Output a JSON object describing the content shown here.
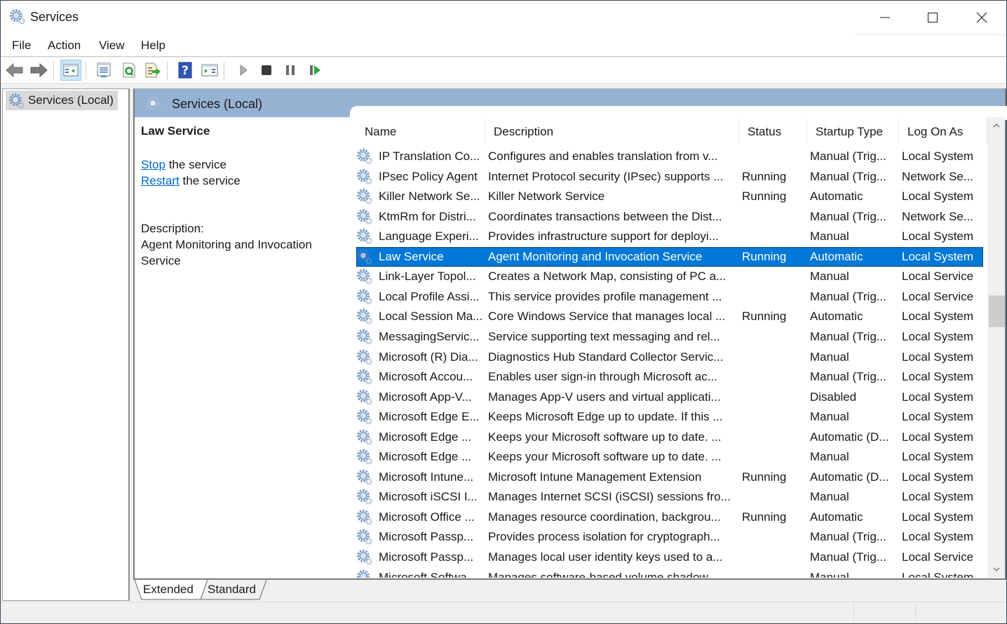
{
  "window": {
    "title": "Services",
    "app_icon": "services-gear-icon",
    "controls": {
      "minimize": "minimize-icon",
      "maximize": "maximize-icon",
      "close": "close-icon"
    }
  },
  "menu": {
    "items": [
      {
        "label": "File"
      },
      {
        "label": "Action"
      },
      {
        "label": "View"
      },
      {
        "label": "Help"
      }
    ]
  },
  "toolbar": {
    "buttons": [
      {
        "name": "back-button",
        "icon": "back-arrow-icon"
      },
      {
        "name": "forward-button",
        "icon": "forward-arrow-icon"
      },
      {
        "name": "show-hide-console-tree-button",
        "icon": "console-tree-icon",
        "active": true
      },
      {
        "name": "properties-button",
        "icon": "properties-icon"
      },
      {
        "name": "refresh-button",
        "icon": "refresh-icon"
      },
      {
        "name": "export-list-button",
        "icon": "export-list-icon"
      },
      {
        "name": "help-button",
        "icon": "help-icon",
        "glyph": "?"
      },
      {
        "name": "show-action-pane-button",
        "icon": "action-pane-icon"
      },
      {
        "name": "start-service-button",
        "icon": "play-icon"
      },
      {
        "name": "stop-service-button",
        "icon": "stop-icon"
      },
      {
        "name": "pause-service-button",
        "icon": "pause-icon"
      },
      {
        "name": "restart-service-button",
        "icon": "restart-icon"
      }
    ]
  },
  "tree": {
    "items": [
      {
        "label": "Services (Local)",
        "icon": "services-gear-icon",
        "selected": true
      }
    ]
  },
  "main": {
    "header_title": "Services (Local)",
    "info": {
      "service_name": "Law Service",
      "actions": [
        {
          "link": "Stop",
          "rest": " the service"
        },
        {
          "link": "Restart",
          "rest": " the service"
        }
      ],
      "description_label": "Description:",
      "description": "Agent Monitoring and Invocation Service"
    },
    "columns": [
      {
        "label": "Name",
        "sorted": "ascending",
        "sort_glyph": "^"
      },
      {
        "label": "Description"
      },
      {
        "label": "Status"
      },
      {
        "label": "Startup Type"
      },
      {
        "label": "Log On As"
      }
    ],
    "rows": [
      {
        "name": "IP Translation Co...",
        "description": "Configures and enables translation from v...",
        "status": "",
        "startup": "Manual (Trig...",
        "logon": "Local System"
      },
      {
        "name": "IPsec Policy Agent",
        "description": "Internet Protocol security (IPsec) supports ...",
        "status": "Running",
        "startup": "Manual (Trig...",
        "logon": "Network Se..."
      },
      {
        "name": "Killer Network Se...",
        "description": "Killer Network Service",
        "status": "Running",
        "startup": "Automatic",
        "logon": "Local System"
      },
      {
        "name": "KtmRm for Distri...",
        "description": "Coordinates transactions between the Dist...",
        "status": "",
        "startup": "Manual (Trig...",
        "logon": "Network Se..."
      },
      {
        "name": "Language Experi...",
        "description": "Provides infrastructure support for deployi...",
        "status": "",
        "startup": "Manual",
        "logon": "Local System"
      },
      {
        "name": "Law Service",
        "description": "Agent Monitoring and Invocation Service",
        "status": "Running",
        "startup": "Automatic",
        "logon": "Local System",
        "selected": true
      },
      {
        "name": "Link-Layer Topol...",
        "description": "Creates a Network Map, consisting of PC a...",
        "status": "",
        "startup": "Manual",
        "logon": "Local Service"
      },
      {
        "name": "Local Profile Assi...",
        "description": "This service provides profile management ...",
        "status": "",
        "startup": "Manual (Trig...",
        "logon": "Local Service"
      },
      {
        "name": "Local Session Ma...",
        "description": "Core Windows Service that manages local ...",
        "status": "Running",
        "startup": "Automatic",
        "logon": "Local System"
      },
      {
        "name": "MessagingServic...",
        "description": "Service supporting text messaging and rel...",
        "status": "",
        "startup": "Manual (Trig...",
        "logon": "Local System"
      },
      {
        "name": "Microsoft (R) Dia...",
        "description": "Diagnostics Hub Standard Collector Servic...",
        "status": "",
        "startup": "Manual",
        "logon": "Local System"
      },
      {
        "name": "Microsoft Accou...",
        "description": "Enables user sign-in through Microsoft ac...",
        "status": "",
        "startup": "Manual (Trig...",
        "logon": "Local System"
      },
      {
        "name": "Microsoft App-V...",
        "description": "Manages App-V users and virtual applicati...",
        "status": "",
        "startup": "Disabled",
        "logon": "Local System"
      },
      {
        "name": "Microsoft Edge E...",
        "description": "Keeps Microsoft Edge up to update. If this ...",
        "status": "",
        "startup": "Manual",
        "logon": "Local System"
      },
      {
        "name": "Microsoft Edge ...",
        "description": "Keeps your Microsoft software up to date. ...",
        "status": "",
        "startup": "Automatic (D...",
        "logon": "Local System"
      },
      {
        "name": "Microsoft Edge ...",
        "description": "Keeps your Microsoft software up to date. ...",
        "status": "",
        "startup": "Manual",
        "logon": "Local System"
      },
      {
        "name": "Microsoft Intune...",
        "description": "Microsoft Intune Management Extension",
        "status": "Running",
        "startup": "Automatic (D...",
        "logon": "Local System"
      },
      {
        "name": "Microsoft iSCSI I...",
        "description": "Manages Internet SCSI (iSCSI) sessions fro...",
        "status": "",
        "startup": "Manual",
        "logon": "Local System"
      },
      {
        "name": "Microsoft Office ...",
        "description": "Manages resource coordination, backgrou...",
        "status": "Running",
        "startup": "Automatic",
        "logon": "Local System"
      },
      {
        "name": "Microsoft Passp...",
        "description": "Provides process isolation for cryptograph...",
        "status": "",
        "startup": "Manual (Trig...",
        "logon": "Local System"
      },
      {
        "name": "Microsoft Passp...",
        "description": "Manages local user identity keys used to a...",
        "status": "",
        "startup": "Manual (Trig...",
        "logon": "Local Service"
      },
      {
        "name": "Microsoft Softwa...",
        "description": "Manages software-based volume shadow ...",
        "status": "",
        "startup": "Manual",
        "logon": "Local System"
      }
    ],
    "scroll": {
      "position_fraction": 0.42
    }
  },
  "tabs": [
    {
      "label": "Extended",
      "active": true
    },
    {
      "label": "Standard",
      "active": false
    }
  ],
  "colors": {
    "selection": "#0078d7",
    "header_band": "#97b3d3",
    "link": "#0066cc"
  }
}
